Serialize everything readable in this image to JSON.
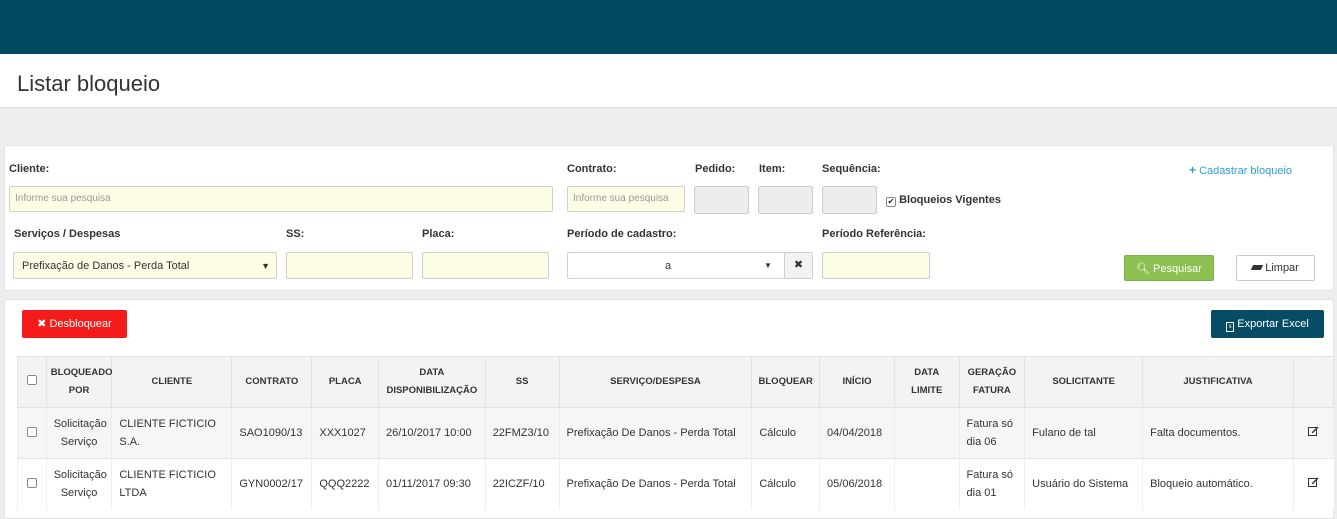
{
  "page": {
    "title": "Listar bloqueio"
  },
  "filters": {
    "cliente": {
      "label": "Cliente:",
      "placeholder": "Informe sua pesquisa"
    },
    "contrato": {
      "label": "Contrato:",
      "placeholder": "Informe sua pesquisa"
    },
    "pedido": {
      "label": "Pedido:"
    },
    "item": {
      "label": "Item:"
    },
    "sequencia": {
      "label": "Sequência:"
    },
    "vigentes": {
      "label": "Bloqueios Vigentes",
      "checked": true
    },
    "cadastrar": {
      "label": "Cadastrar bloqueio"
    },
    "servicos": {
      "label": "Serviços / Despesas",
      "value": "Prefixação de Danos - Perda Total"
    },
    "ss": {
      "label": "SS:"
    },
    "placa": {
      "label": "Placa:"
    },
    "periodo_cadastro": {
      "label": "Período de cadastro:",
      "separator": "a"
    },
    "periodo_referencia": {
      "label": "Período Referência:"
    },
    "search_button": "Pesquisar",
    "clear_button": "Limpar"
  },
  "actions": {
    "unblock_button": "Desbloquear",
    "export_button": "Exportar Excel"
  },
  "table": {
    "headers": {
      "bloqueado_por": [
        "BLOQUEADO",
        "POR"
      ],
      "cliente": "CLIENTE",
      "contrato": "CONTRATO",
      "placa": "PLACA",
      "data_disp": [
        "DATA",
        "DISPONIBILIZAÇÃO"
      ],
      "ss": "SS",
      "servico": "SERVIÇO/DESPESA",
      "bloquear": "BLOQUEAR",
      "inicio": "INÍCIO",
      "data_limite": [
        "DATA",
        "LIMITE"
      ],
      "geracao": [
        "GERAÇÃO",
        "FATURA"
      ],
      "solicitante": "SOLICITANTE",
      "justificativa": "JUSTIFICATIVA"
    },
    "rows": [
      {
        "bloqueado_por": [
          "Solicitação",
          "Serviço"
        ],
        "cliente": "CLIENTE FICTICIO S.A.",
        "contrato": "SAO1090/13",
        "placa": "XXX1027",
        "data_disp": "26/10/2017 10:00",
        "ss": "22FMZ3/10",
        "servico": "Prefixação De Danos - Perda Total",
        "bloquear": "Cálculo",
        "inicio": "04/04/2018",
        "data_limite": "",
        "geracao": [
          "Fatura só",
          "dia 06"
        ],
        "solicitante": "Fulano de tal",
        "justificativa": "Falta documentos."
      },
      {
        "bloqueado_por": [
          "Solicitação",
          "Serviço"
        ],
        "cliente": "CLIENTE FICTICIO LTDA",
        "contrato": "GYN0002/17",
        "placa": "QQQ2222",
        "data_disp": "01/11/2017 09:30",
        "ss": "22ICZF/10",
        "servico": "Prefixação De Danos - Perda Total",
        "bloquear": "Cálculo",
        "inicio": "05/06/2018",
        "data_limite": "",
        "geracao": [
          "Fatura só",
          "dia 01"
        ],
        "solicitante": "Usuário do Sistema",
        "justificativa": "Bloqueio automático."
      }
    ]
  },
  "colors": {
    "topbar": "#024860",
    "search": "#8cc152",
    "unblock": "#f41b1b",
    "export": "#064c64",
    "link": "#2a9fd8"
  }
}
